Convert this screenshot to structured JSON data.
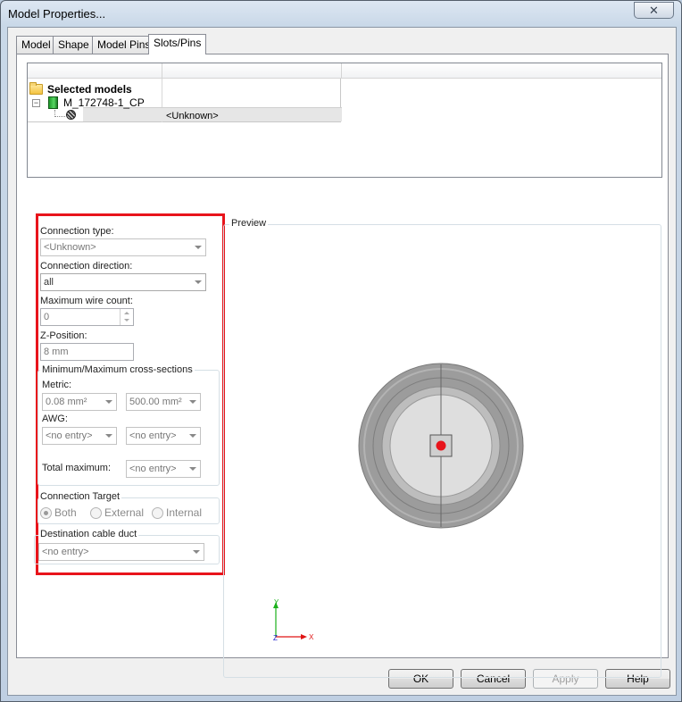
{
  "window": {
    "title": "Model Properties...",
    "close_glyph": "✕"
  },
  "tabs": [
    {
      "label": "Model"
    },
    {
      "label": "Shape"
    },
    {
      "label": "Model Pins"
    },
    {
      "label": "Slots/Pins"
    }
  ],
  "active_tab": "Slots/Pins",
  "tree": {
    "root_label": "Selected models",
    "expander_glyph": "−",
    "model_label": "M_172748-1_CP",
    "slot_value": "<Unknown>"
  },
  "form": {
    "connection_type": {
      "label": "Connection type:",
      "value": "<Unknown>"
    },
    "connection_direction": {
      "label": "Connection direction:",
      "value": "all"
    },
    "max_wire_count": {
      "label": "Maximum wire count:",
      "value": "0"
    },
    "z_position": {
      "label": "Z-Position:",
      "value": "8 mm"
    },
    "cross_sections": {
      "title": "Minimum/Maximum cross-sections",
      "metric_label": "Metric:",
      "metric_min": "0.08 mm²",
      "metric_max": "500.00 mm²",
      "awg_label": "AWG:",
      "awg_min": "<no entry>",
      "awg_max": "<no entry>",
      "total_label": "Total maximum:",
      "total_value": "<no entry>"
    },
    "connection_target": {
      "title": "Connection Target",
      "options": [
        "Both",
        "External",
        "Internal"
      ],
      "selected": "Both"
    },
    "destination_duct": {
      "title": "Destination cable duct",
      "value": "<no entry>"
    }
  },
  "preview": {
    "title": "Preview",
    "axis_y": "Y",
    "axis_x": "X",
    "axis_z": "Z",
    "pin_color": "#e8141b"
  },
  "buttons": {
    "ok": "OK",
    "cancel": "Cancel",
    "apply": "Apply",
    "help": "Help"
  }
}
